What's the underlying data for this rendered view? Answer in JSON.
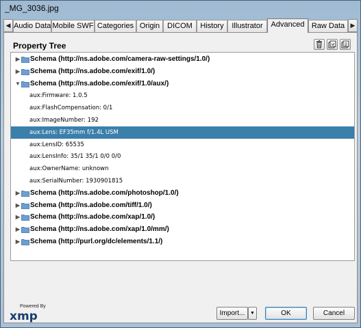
{
  "window": {
    "title": "_MG_3036.jpg"
  },
  "tabs": [
    {
      "label": "Audio Data"
    },
    {
      "label": "Mobile SWF"
    },
    {
      "label": "Categories"
    },
    {
      "label": "Origin"
    },
    {
      "label": "DICOM"
    },
    {
      "label": "History"
    },
    {
      "label": "Illustrator"
    },
    {
      "label": "Advanced",
      "active": true
    },
    {
      "label": "Raw Data"
    }
  ],
  "tab_scroll": {
    "left_icon": "◀",
    "right_icon": "▶"
  },
  "panel": {
    "title": "Property Tree",
    "tools": [
      {
        "icon": "trash-icon"
      },
      {
        "icon": "save-icon"
      },
      {
        "icon": "replace-icon"
      }
    ]
  },
  "tree": [
    {
      "kind": "schema",
      "expanded": false,
      "label": "Schema (http://ns.adobe.com/camera-raw-settings/1.0/)"
    },
    {
      "kind": "schema",
      "expanded": false,
      "label": "Schema (http://ns.adobe.com/exif/1.0/)"
    },
    {
      "kind": "schema",
      "expanded": true,
      "label": "Schema (http://ns.adobe.com/exif/1.0/aux/)"
    },
    {
      "kind": "prop",
      "label": "aux:Firmware: 1.0.5"
    },
    {
      "kind": "prop",
      "label": "aux:FlashCompensation: 0/1"
    },
    {
      "kind": "prop",
      "label": "aux:ImageNumber: 192"
    },
    {
      "kind": "prop",
      "label": "aux:Lens: EF35mm f/1.4L USM",
      "selected": true
    },
    {
      "kind": "prop",
      "label": "aux:LensID: 65535"
    },
    {
      "kind": "prop",
      "label": "aux:LensInfo: 35/1 35/1 0/0 0/0"
    },
    {
      "kind": "prop",
      "label": "aux:OwnerName: unknown"
    },
    {
      "kind": "prop",
      "label": "aux:SerialNumber: 1930901815"
    },
    {
      "kind": "schema",
      "expanded": false,
      "label": "Schema (http://ns.adobe.com/photoshop/1.0/)"
    },
    {
      "kind": "schema",
      "expanded": false,
      "label": "Schema (http://ns.adobe.com/tiff/1.0/)"
    },
    {
      "kind": "schema",
      "expanded": false,
      "label": "Schema (http://ns.adobe.com/xap/1.0/)"
    },
    {
      "kind": "schema",
      "expanded": false,
      "label": "Schema (http://ns.adobe.com/xap/1.0/mm/)"
    },
    {
      "kind": "schema",
      "expanded": false,
      "label": "Schema (http://purl.org/dc/elements/1.1/)"
    }
  ],
  "footer": {
    "powered_by": "Powered By",
    "logo_text": "xmp",
    "import_label": "Import...",
    "import_arrow": "▼",
    "ok_label": "OK",
    "cancel_label": "Cancel"
  },
  "colors": {
    "selection": "#3b7fab",
    "folder": "#6d9fd3"
  }
}
